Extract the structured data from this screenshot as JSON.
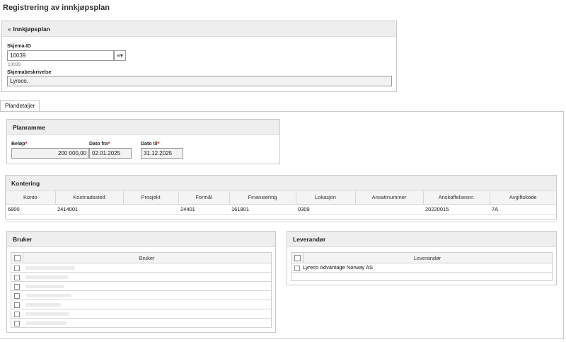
{
  "page": {
    "title": "Registrering av innkjøpsplan"
  },
  "innkjopsplan": {
    "header": "Innkjøpsplan",
    "skjema_id_label": "Skjema-ID",
    "skjema_id_value": "10039",
    "skjema_id_subtext": "10039",
    "list_icon": "≡▾",
    "beskrivelse_label": "Skjemabeskrivelse",
    "beskrivelse_value": "Lyreco,"
  },
  "tabs": [
    {
      "label": "Plandetaljer",
      "active": true
    }
  ],
  "planramme": {
    "header": "Planramme",
    "belop_label": "Beløp",
    "belop_value": "200 000,00",
    "dato_fra_label": "Dato fra",
    "dato_fra_value": "02.01.2025",
    "dato_til_label": "Dato til",
    "dato_til_value": "31.12.2025",
    "required_mark": "*"
  },
  "kontering": {
    "header": "Kontering",
    "columns": [
      "Konto",
      "Kostnadssted",
      "Prosjekt",
      "Formål",
      "Finansiering",
      "Lokasjon",
      "Ansattnummer",
      "Anskaffelsesnr.",
      "Avgiftskode"
    ],
    "rows": [
      [
        "6800",
        "2414001",
        "",
        "24401",
        "161801",
        "0309",
        "",
        "20220015",
        "7A"
      ]
    ]
  },
  "bruker": {
    "header": "Bruker",
    "column": "Bruker",
    "rows": [
      "",
      "",
      "",
      "",
      "",
      "",
      ""
    ]
  },
  "leverandor": {
    "header": "Leverandør",
    "column": "Leverandør",
    "rows": [
      "Lyreco Advantage Norway AS"
    ]
  },
  "colors": {
    "panel_header_bg": "#eeeeee",
    "border": "#c9c9c9",
    "required": "#cc0000"
  }
}
